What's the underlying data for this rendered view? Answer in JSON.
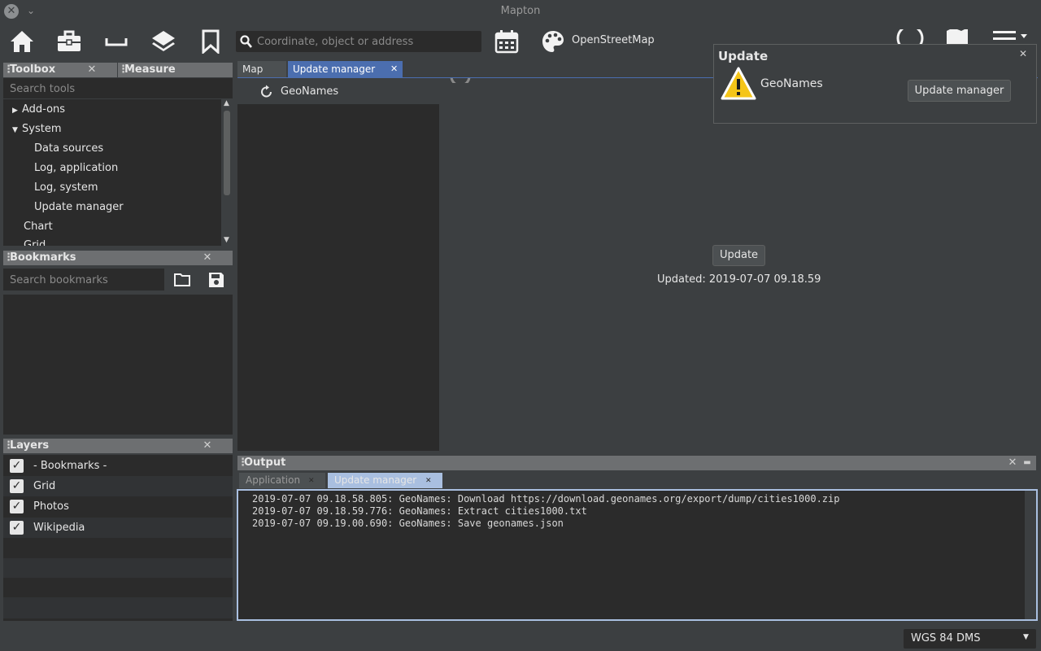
{
  "window": {
    "title": "Mapton"
  },
  "toolbar": {
    "search_placeholder": "Coordinate, object or address",
    "map_provider": "OpenStreetMap"
  },
  "toolbox": {
    "title": "Toolbox",
    "measure_tab": "Measure",
    "search_placeholder": "Search tools",
    "items": [
      {
        "label": "Add-ons",
        "expanded": false
      },
      {
        "label": "System",
        "expanded": true
      },
      {
        "label": "Data sources"
      },
      {
        "label": "Log, application"
      },
      {
        "label": "Log, system"
      },
      {
        "label": "Update manager"
      },
      {
        "label": "Chart"
      },
      {
        "label": "Grid"
      }
    ]
  },
  "bookmarks": {
    "title": "Bookmarks",
    "search_placeholder": "Search bookmarks"
  },
  "layers": {
    "title": "Layers",
    "items": [
      {
        "label": "- Bookmarks -",
        "checked": true
      },
      {
        "label": "Grid",
        "checked": true
      },
      {
        "label": "Photos",
        "checked": true
      },
      {
        "label": "Wikipedia",
        "checked": true
      }
    ]
  },
  "editor_tabs": {
    "map": "Map",
    "update_manager": "Update manager"
  },
  "update_manager": {
    "list": [
      {
        "label": "GeoNames"
      }
    ],
    "update_button": "Update",
    "updated_text": "Updated: 2019-07-07 09.18.59"
  },
  "output": {
    "title": "Output",
    "tabs": {
      "application": "Application",
      "update_manager": "Update manager"
    },
    "lines": [
      "2019-07-07 09.18.58.805: GeoNames: Download https://download.geonames.org/export/dump/cities1000.zip",
      "2019-07-07 09.18.59.776: GeoNames: Extract cities1000.txt",
      "2019-07-07 09.19.00.690: GeoNames: Save geonames.json"
    ]
  },
  "popup": {
    "title": "Update",
    "message": "GeoNames",
    "button": "Update manager"
  },
  "statusbar": {
    "crs": "WGS 84 DMS"
  },
  "colors": {
    "accent_tab": "#4b6eaf",
    "warning": "#f5c518"
  }
}
